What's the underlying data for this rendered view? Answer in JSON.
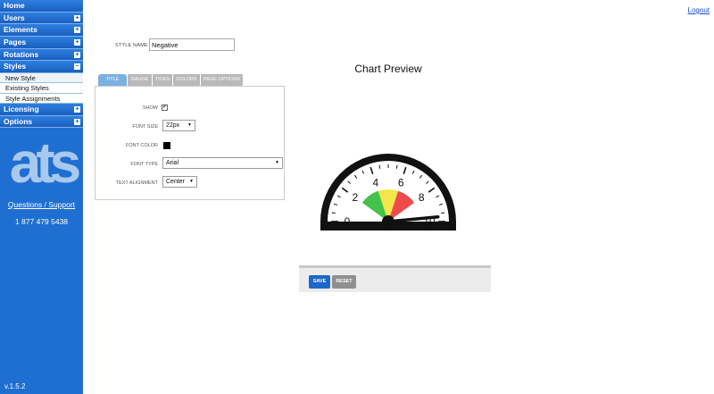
{
  "sidebar": {
    "items": [
      {
        "label": "Home",
        "toggle": ""
      },
      {
        "label": "Users",
        "toggle": "+"
      },
      {
        "label": "Elements",
        "toggle": "+"
      },
      {
        "label": "Pages",
        "toggle": "+"
      },
      {
        "label": "Rotations",
        "toggle": "+"
      },
      {
        "label": "Styles",
        "toggle": "−"
      }
    ],
    "styles_subitems": [
      "New Style",
      "Existing Styles",
      "Style Assignments"
    ],
    "items_after": [
      {
        "label": "Licensing",
        "toggle": "+"
      },
      {
        "label": "Options",
        "toggle": "+"
      }
    ],
    "logo_text": "ats",
    "support_link": "Questions / Support",
    "phone": "1 877 479 5438",
    "version": "v.1.5.2"
  },
  "header": {
    "logout": "Logout"
  },
  "form": {
    "style_name_label": "STYLE NAME",
    "style_name_value": "Negative",
    "tabs": [
      "TITLE",
      "GAUGE",
      "TICKS",
      "COLORS",
      "PAGE OPTIONS"
    ],
    "active_tab": "TITLE",
    "fields": {
      "show_label": "SHOW",
      "show_checked": "✔",
      "font_size_label": "FONT SIZE",
      "font_size_value": "22px",
      "font_color_label": "FONT COLOR",
      "font_color_value": "#000000",
      "font_type_label": "FONT TYPE",
      "font_type_value": "Arial",
      "text_alignment_label": "TEXT ALIGNMENT",
      "text_alignment_value": "Center"
    }
  },
  "preview": {
    "title": "Chart Preview",
    "gauge": {
      "min": 0,
      "max": 10,
      "value": 9.7,
      "tick_labels": [
        "0",
        "2",
        "4",
        "6",
        "8",
        "10"
      ],
      "bands": [
        {
          "from": 2,
          "to": 4,
          "color": "#44c24a"
        },
        {
          "from": 4,
          "to": 6,
          "color": "#f2e64a"
        },
        {
          "from": 6,
          "to": 8,
          "color": "#ee4a4a"
        }
      ]
    }
  },
  "actions": {
    "save": "SAVE",
    "reset": "RESET"
  }
}
